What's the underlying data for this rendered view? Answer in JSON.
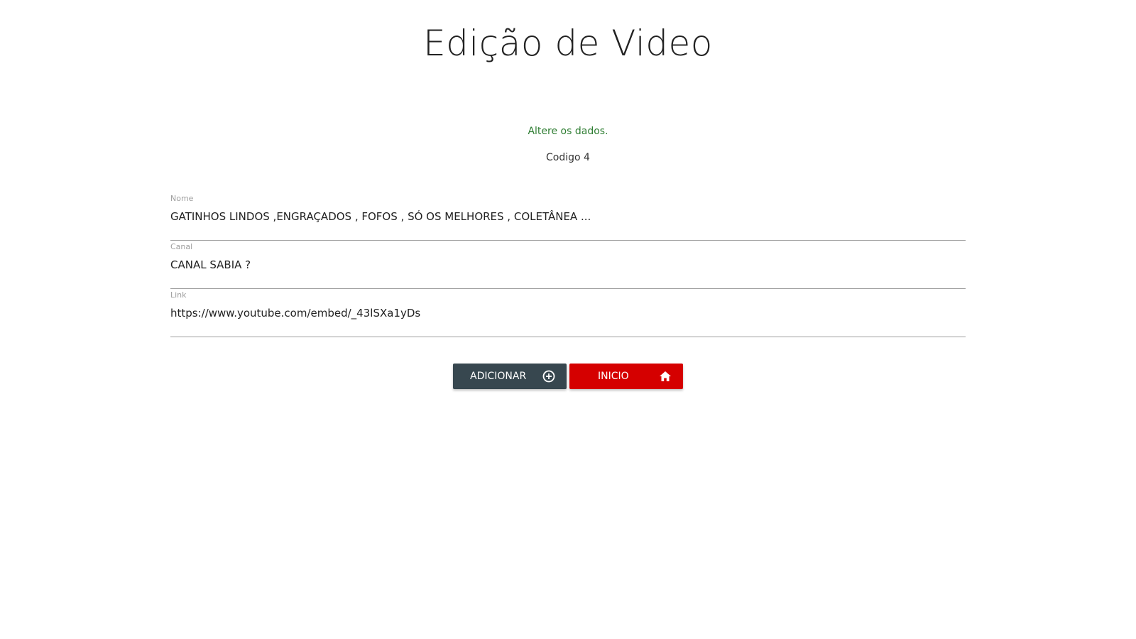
{
  "header": {
    "title": "Edição de Video"
  },
  "status": {
    "message": "Altere os dados.",
    "message_color": "#2e7d32",
    "code": "Codigo 4"
  },
  "form": {
    "fields": [
      {
        "label": "Nome",
        "value": "GATINHOS LINDOS ,ENGRAÇADOS , FOFOS , SÓ OS MELHORES , COLETÂNEA ..."
      },
      {
        "label": "Canal",
        "value": "CANAL SABIA ?"
      },
      {
        "label": "Link",
        "value": "https://www.youtube.com/embed/_43lSXa1yDs"
      }
    ]
  },
  "actions": {
    "add_label": "ADICIONAR",
    "add_icon": "plus-circle-icon",
    "add_color": "#37474f",
    "home_label": "INICIO",
    "home_icon": "home-icon",
    "home_color": "#d50000"
  }
}
